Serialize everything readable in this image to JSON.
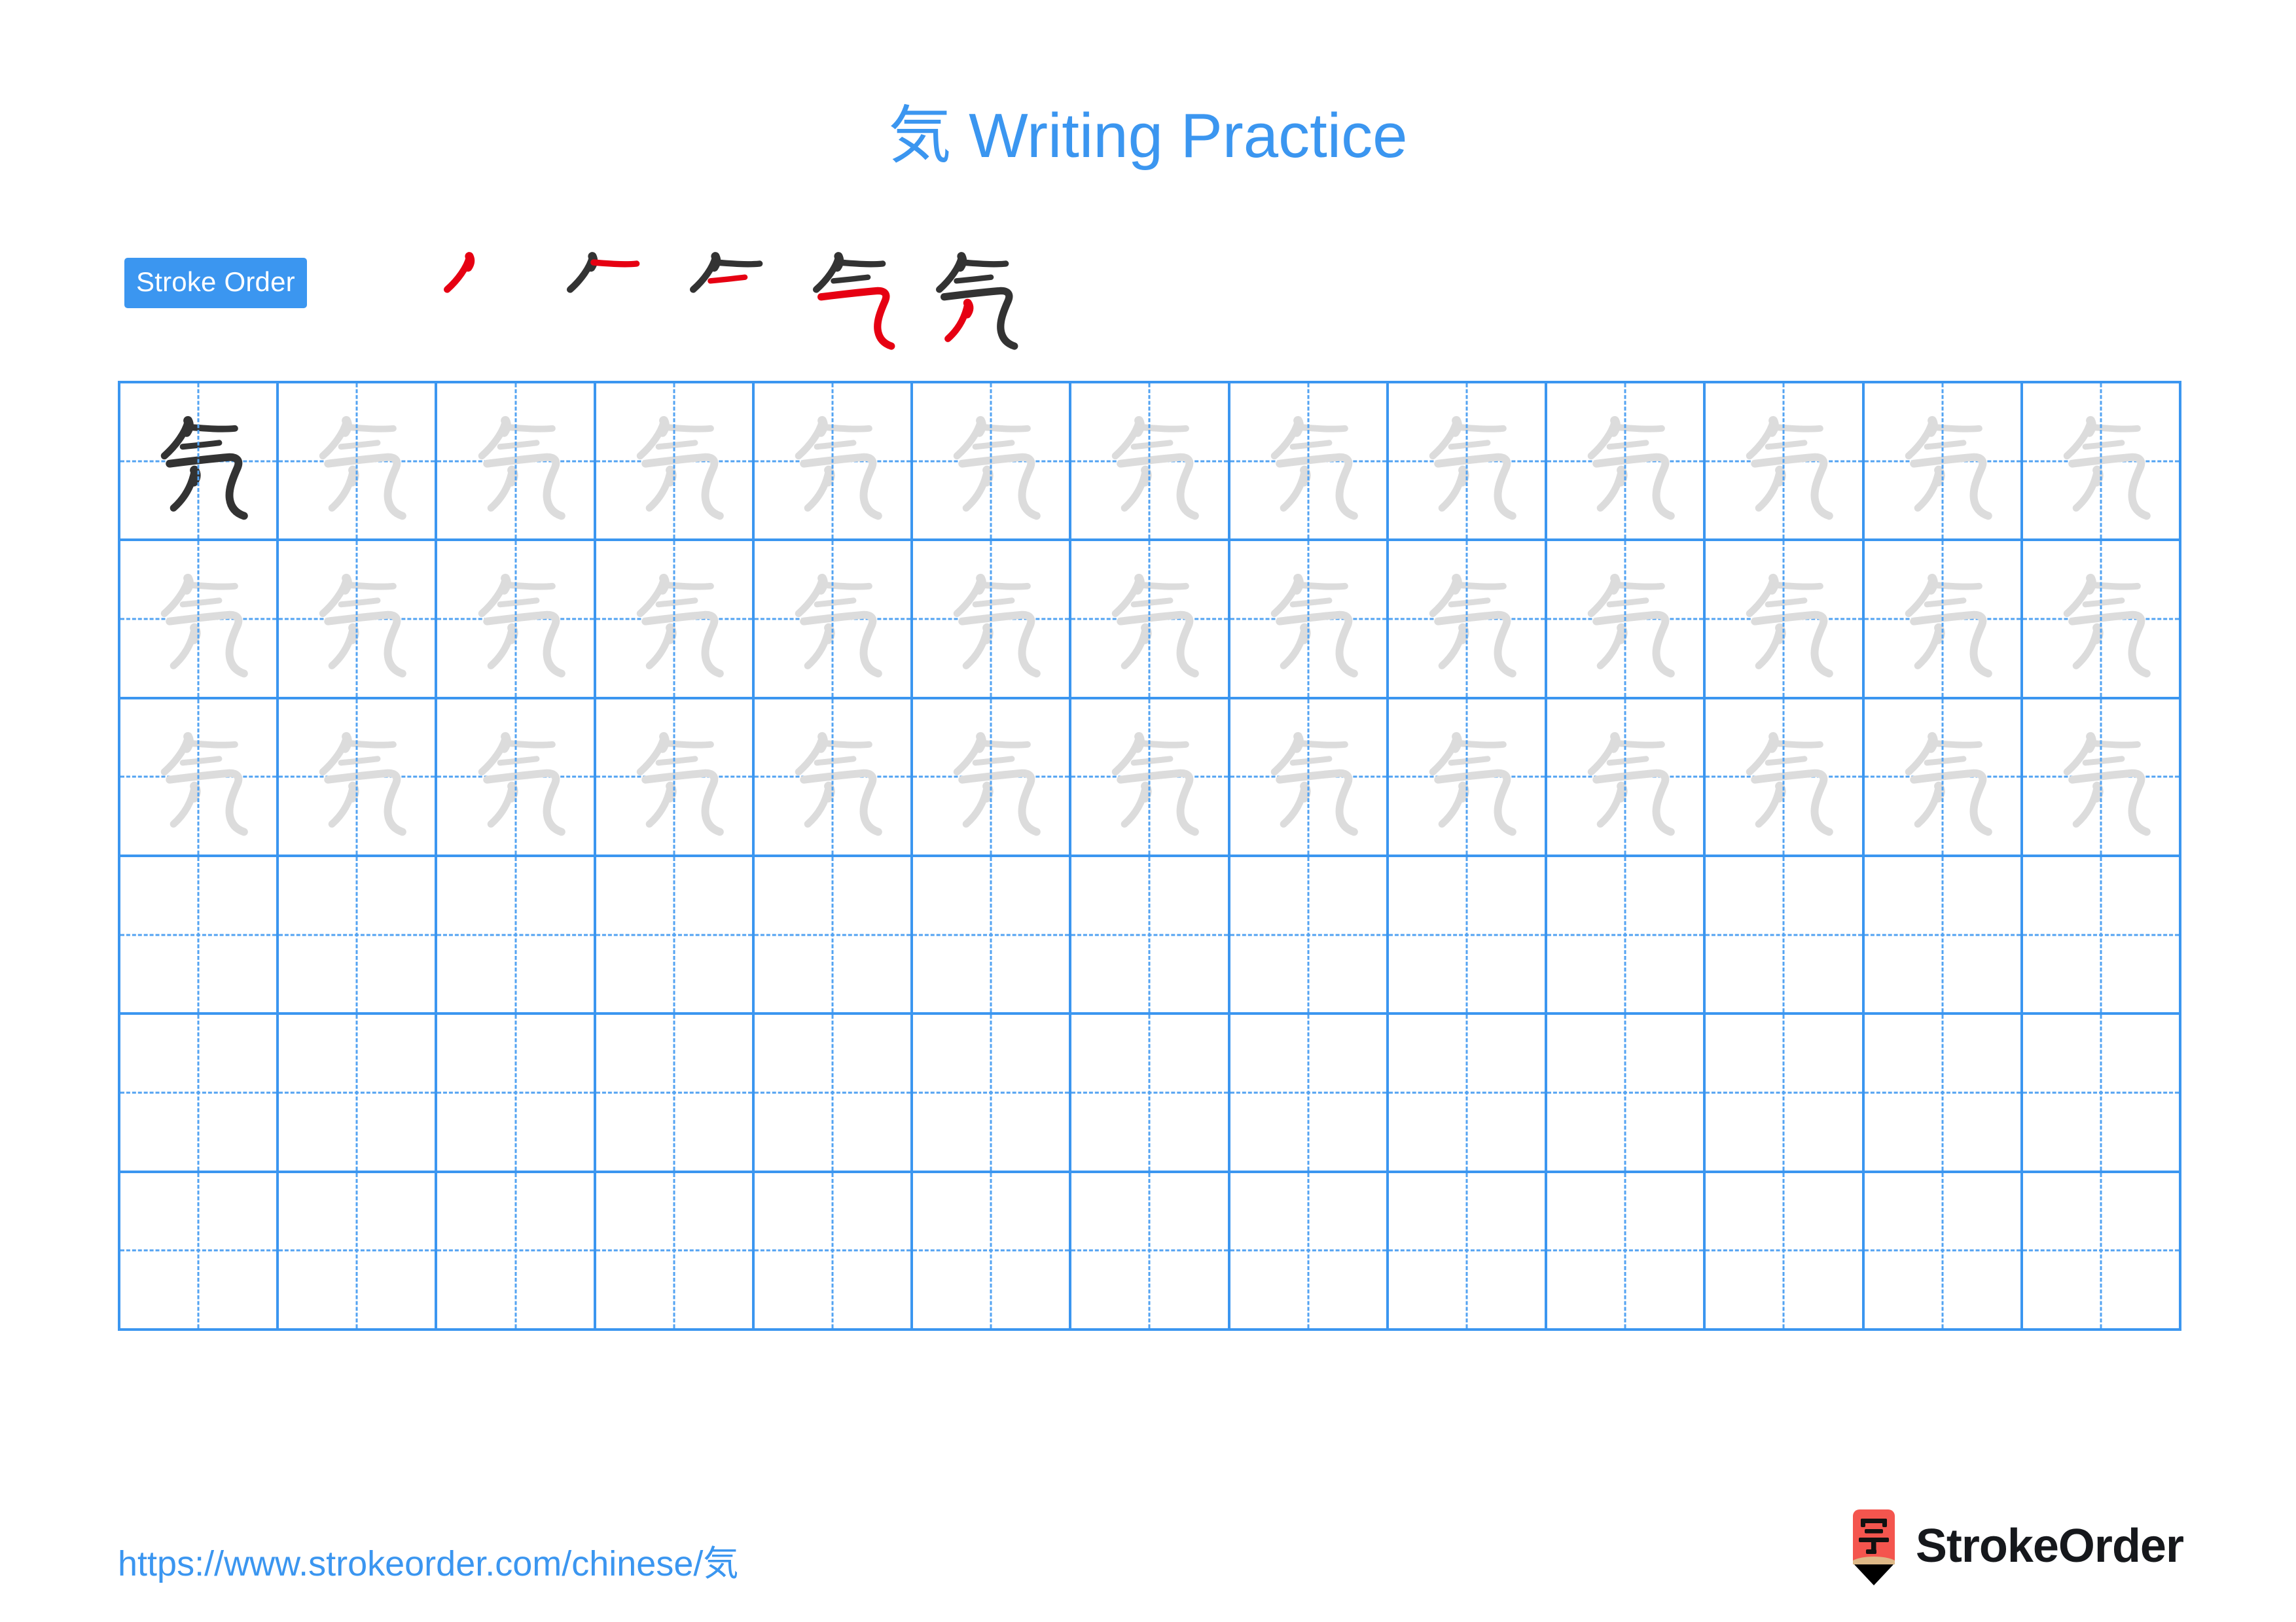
{
  "page": {
    "character": "気",
    "title": "気 Writing Practice",
    "title_suffix": " Writing Practice",
    "background_color": "#ffffff"
  },
  "colors": {
    "accent_blue": "#3B96F0",
    "grid_line": "#3B96F0",
    "grid_dashed": "#53A3F2",
    "trace_gray": "#DCDCDC",
    "ink_dark": "#333333",
    "stroke_highlight_red": "#E60012",
    "logo_red": "#F4554E",
    "logo_wood": "#DEB887",
    "logo_tip": "#000000"
  },
  "stroke_order": {
    "badge_label": "Stroke Order",
    "total_strokes": 5,
    "steps": [
      {
        "index": 1,
        "new_stroke": 1,
        "completed_strokes": 0
      },
      {
        "index": 2,
        "new_stroke": 2,
        "completed_strokes": 1
      },
      {
        "index": 3,
        "new_stroke": 3,
        "completed_strokes": 2
      },
      {
        "index": 4,
        "new_stroke": 4,
        "completed_strokes": 3
      },
      {
        "index": 5,
        "new_stroke": 5,
        "completed_strokes": 4
      }
    ]
  },
  "grid": {
    "columns": 13,
    "rows": 6,
    "cells": [
      [
        "dark",
        "trace",
        "trace",
        "trace",
        "trace",
        "trace",
        "trace",
        "trace",
        "trace",
        "trace",
        "trace",
        "trace",
        "trace"
      ],
      [
        "trace",
        "trace",
        "trace",
        "trace",
        "trace",
        "trace",
        "trace",
        "trace",
        "trace",
        "trace",
        "trace",
        "trace",
        "trace"
      ],
      [
        "trace",
        "trace",
        "trace",
        "trace",
        "trace",
        "trace",
        "trace",
        "trace",
        "trace",
        "trace",
        "trace",
        "trace",
        "trace"
      ],
      [
        "empty",
        "empty",
        "empty",
        "empty",
        "empty",
        "empty",
        "empty",
        "empty",
        "empty",
        "empty",
        "empty",
        "empty",
        "empty"
      ],
      [
        "empty",
        "empty",
        "empty",
        "empty",
        "empty",
        "empty",
        "empty",
        "empty",
        "empty",
        "empty",
        "empty",
        "empty",
        "empty"
      ],
      [
        "empty",
        "empty",
        "empty",
        "empty",
        "empty",
        "empty",
        "empty",
        "empty",
        "empty",
        "empty",
        "empty",
        "empty",
        "empty"
      ]
    ]
  },
  "footer": {
    "url": "https://www.strokeorder.com/chinese/気",
    "brand_name": "StrokeOrder",
    "logo_character": "字"
  }
}
